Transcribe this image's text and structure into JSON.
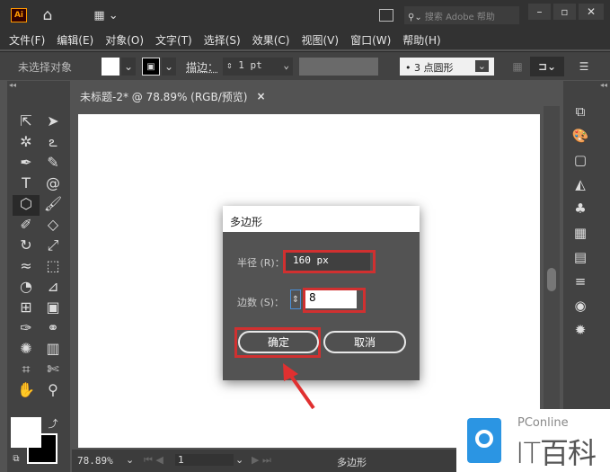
{
  "app": {
    "logo": "Ai",
    "search_placeholder": "搜索 Adobe 帮助"
  },
  "menu": [
    "文件(F)",
    "编辑(E)",
    "对象(O)",
    "文字(T)",
    "选择(S)",
    "效果(C)",
    "视图(V)",
    "窗口(W)",
    "帮助(H)"
  ],
  "control": {
    "selection": "未选择对象",
    "stroke_label": "描边：",
    "stroke_value": "1 pt",
    "brush": "3 点圆形"
  },
  "tab": {
    "title": "未标题-2* @ 78.89% (RGB/预览)",
    "close": "×"
  },
  "dialog": {
    "title": "多边形",
    "radius_label": "半径 (R)：",
    "radius_value": "160 px",
    "sides_label": "边数 (S)：",
    "sides_value": "8",
    "ok": "确定",
    "cancel": "取消"
  },
  "status": {
    "zoom": "78.89%",
    "page": "1",
    "tool": "多边形"
  },
  "watermark": {
    "top": "PConline",
    "bottom": "IT百科"
  },
  "colors": {
    "highlight": "#d03030",
    "arrow": "#e03030",
    "logo_blue": "#2b95e3"
  }
}
